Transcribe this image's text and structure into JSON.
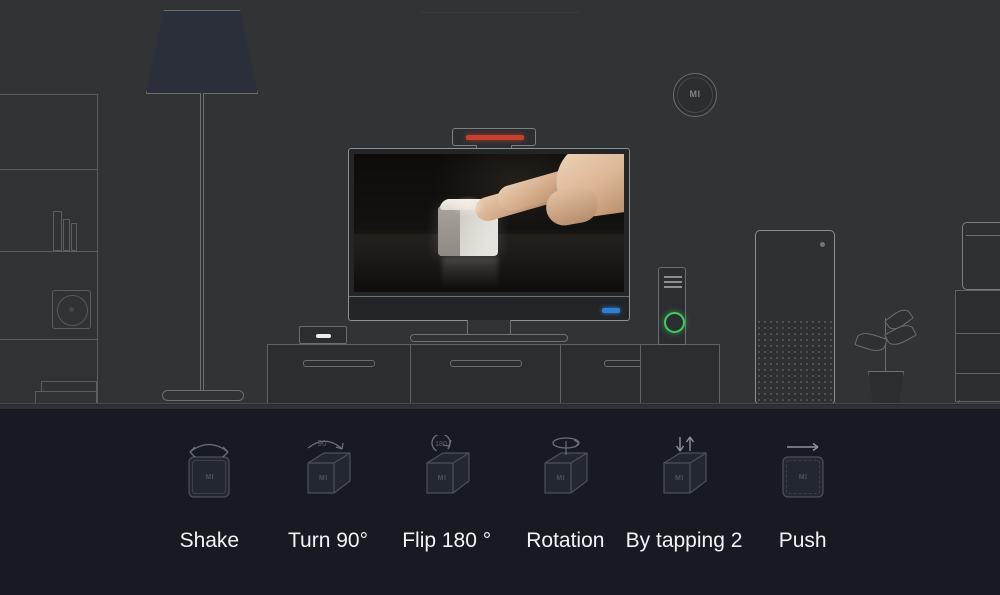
{
  "scene": {
    "name": "living-room-illustration",
    "wall_color": "#313335",
    "floor_color": "#26282b",
    "outline_color": "#5a5e61",
    "devices": {
      "floor_lamp": "floor-lamp",
      "bookshelf": "bookshelf",
      "shelf_speaker": "shelf-speaker",
      "tv": "television",
      "tv_camera_bar": "tv-camera-sensor-bar",
      "tv_camera_led_color": "#c8402a",
      "tv_status_led_color": "#2f7fd6",
      "set_top_box": "set-top-box",
      "tv_cabinet_drawers": 3,
      "router": "router-tower",
      "router_ring_color": "#3fcf5f",
      "tower_speaker": "mesh-tower-speaker",
      "wall_speaker_label": "MI",
      "plant": "potted-plant",
      "microwave": "microwave",
      "right_cabinet": "right-cabinet"
    },
    "tv_content": {
      "name": "hand-tapping-cube-photo",
      "subject": "finger tapping a white smart cube on a dark reflective table"
    }
  },
  "gesture_panel": {
    "background": "#171a20",
    "text_color": "#f2f4f6",
    "items": [
      {
        "label": "Shake",
        "icon": "cube-shake-icon",
        "cube_logo": "MI",
        "annotation": ""
      },
      {
        "label": "Turn 90°",
        "icon": "cube-turn-icon",
        "cube_logo": "MI",
        "annotation": "90"
      },
      {
        "label": "Flip 180 °",
        "icon": "cube-flip-icon",
        "cube_logo": "MI",
        "annotation": "180"
      },
      {
        "label": "Rotation",
        "icon": "cube-rotation-icon",
        "cube_logo": "MI",
        "annotation": ""
      },
      {
        "label": "By tapping 2",
        "icon": "cube-tap-icon",
        "cube_logo": "MI",
        "annotation": ""
      },
      {
        "label": "Push",
        "icon": "cube-push-icon",
        "cube_logo": "MI",
        "annotation": ""
      }
    ]
  }
}
